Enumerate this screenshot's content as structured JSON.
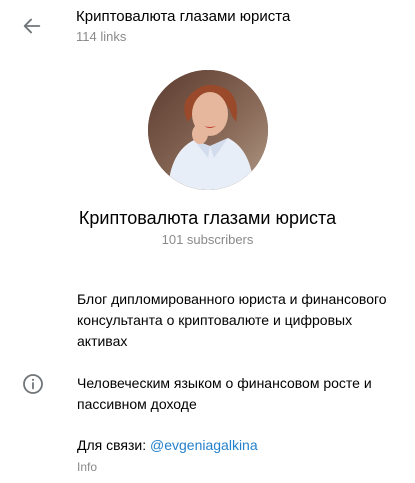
{
  "header": {
    "title": "Криптовалюта глазами юриста",
    "subtitle": "114 links",
    "back_icon": "arrow-left-icon"
  },
  "channel": {
    "name": "Криптовалюта глазами юриста",
    "subscribers": "101 subscribers",
    "avatar": "profile-photo"
  },
  "info": {
    "icon": "info-circle-icon",
    "description": [
      "Блог дипломированного юриста и финансового консультанта о криптовалюте и цифровых активах",
      "Человеческим языком о финансовом росте и пассивном доходе"
    ],
    "contact_label": "Для связи: ",
    "contact_link": "@evgeniagalkina",
    "caption": "Info"
  },
  "colors": {
    "link": "#2481cc",
    "secondary_text": "#8a8a8a",
    "icon": "#707579"
  }
}
